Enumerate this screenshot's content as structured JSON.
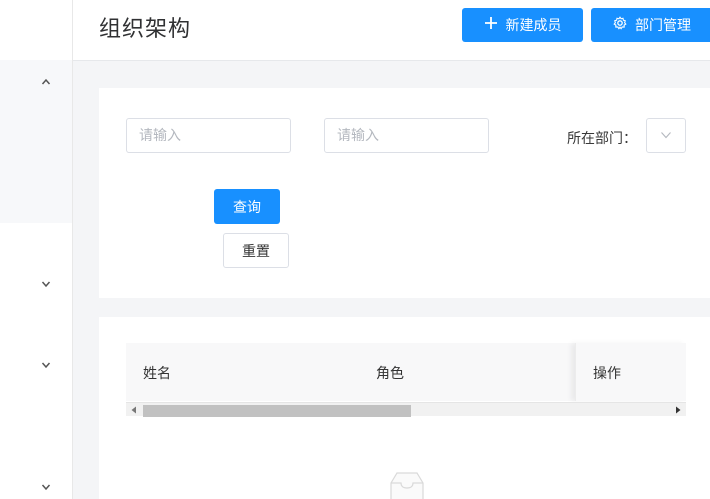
{
  "header": {
    "title": "组织架构",
    "new_member_label": "新建成员",
    "dept_manage_label": "部门管理"
  },
  "filter": {
    "name_placeholder": "请输入",
    "second_placeholder": "请输入",
    "dept_label": "所在部门：",
    "query_label": "查询",
    "reset_label": "重置"
  },
  "table": {
    "columns": [
      "姓名",
      "角色",
      "操作"
    ]
  },
  "sidebar": {
    "icons": [
      "chevron-up-icon",
      "chevron-down-icon",
      "chevron-down-icon",
      "chevron-down-icon"
    ]
  },
  "colors": {
    "primary": "#1890ff",
    "page_bg": "#f4f5f7"
  }
}
